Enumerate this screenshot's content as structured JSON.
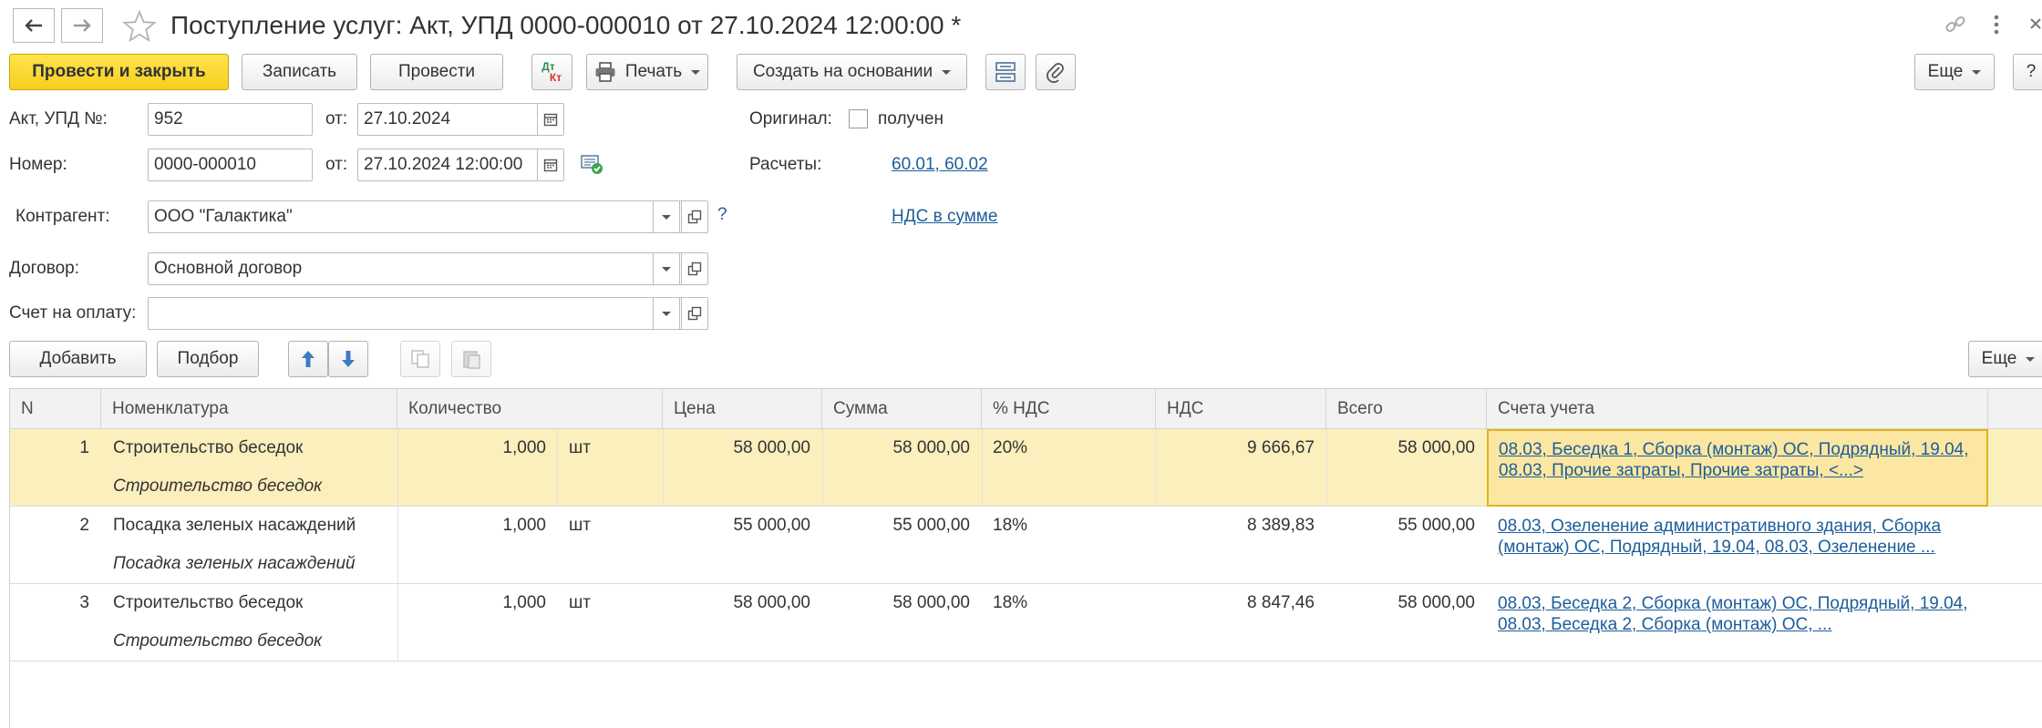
{
  "window": {
    "title": "Поступление услуг: Акт, УПД 0000-000010 от 27.10.2024 12:00:00 *"
  },
  "toolbar": {
    "post_close": "Провести и закрыть",
    "save": "Записать",
    "post": "Провести",
    "dtkt_top": "Дт",
    "dtkt_bottom": "Кт",
    "print": "Печать",
    "create_based": "Создать на основании",
    "more": "Еще",
    "help": "?"
  },
  "form": {
    "act_label": "Акт, УПД №:",
    "act_number": "952",
    "from_label": "от:",
    "act_date": "27.10.2024",
    "original_label": "Оригинал:",
    "original_received_label": "получен",
    "number_label": "Номер:",
    "number_value": "0000-000010",
    "number_datetime": "27.10.2024 12:00:00",
    "settlements_label": "Расчеты:",
    "settlements_link": "60.01, 60.02",
    "counterparty_label": "Контрагент:",
    "counterparty_value": "ООО \"Галактика\"",
    "counterparty_help": "?",
    "vat_link": "НДС в сумме",
    "contract_label": "Договор:",
    "contract_value": "Основной договор",
    "invoice_label": "Счет на оплату:",
    "invoice_value": ""
  },
  "table_toolbar": {
    "add": "Добавить",
    "pick": "Подбор",
    "more": "Еще"
  },
  "table": {
    "columns": [
      "N",
      "Номенклатура",
      "Количество",
      "Цена",
      "Сумма",
      "% НДС",
      "НДС",
      "Всего",
      "Счета учета"
    ],
    "rows": [
      {
        "n": "1",
        "name": "Строительство беседок",
        "name_sub": "Строительство беседок",
        "qty": "1,000",
        "unit": "шт",
        "price": "58 000,00",
        "sum": "58 000,00",
        "vat_rate": "20%",
        "vat": "9 666,67",
        "total": "58 000,00",
        "accounts": "08.03, Беседка 1, Сборка (монтаж) ОС, Подрядный, 19.04, 08.03, Прочие затраты, Прочие затраты, <...>"
      },
      {
        "n": "2",
        "name": "Посадка зеленых насаждений",
        "name_sub": "Посадка зеленых насаждений",
        "qty": "1,000",
        "unit": "шт",
        "price": "55 000,00",
        "sum": "55 000,00",
        "vat_rate": "18%",
        "vat": "8 389,83",
        "total": "55 000,00",
        "accounts": "08.03, Озеленение административного здания, Сборка (монтаж) ОС, Подрядный, 19.04, 08.03, Озеленение ..."
      },
      {
        "n": "3",
        "name": "Строительство беседок",
        "name_sub": "Строительство беседок",
        "qty": "1,000",
        "unit": "шт",
        "price": "58 000,00",
        "sum": "58 000,00",
        "vat_rate": "18%",
        "vat": "8 847,46",
        "total": "58 000,00",
        "accounts": "08.03, Беседка 2, Сборка (монтаж) ОС, Подрядный, 19.04, 08.03, Беседка 2, Сборка (монтаж) ОС, ..."
      }
    ]
  },
  "colors": {
    "primary_button": "#f5cf1f",
    "link": "#1d5d9b",
    "selected_row": "#fbefbd",
    "selected_cell_border": "#e2b21c",
    "header_bg": "#f2f2f2"
  }
}
